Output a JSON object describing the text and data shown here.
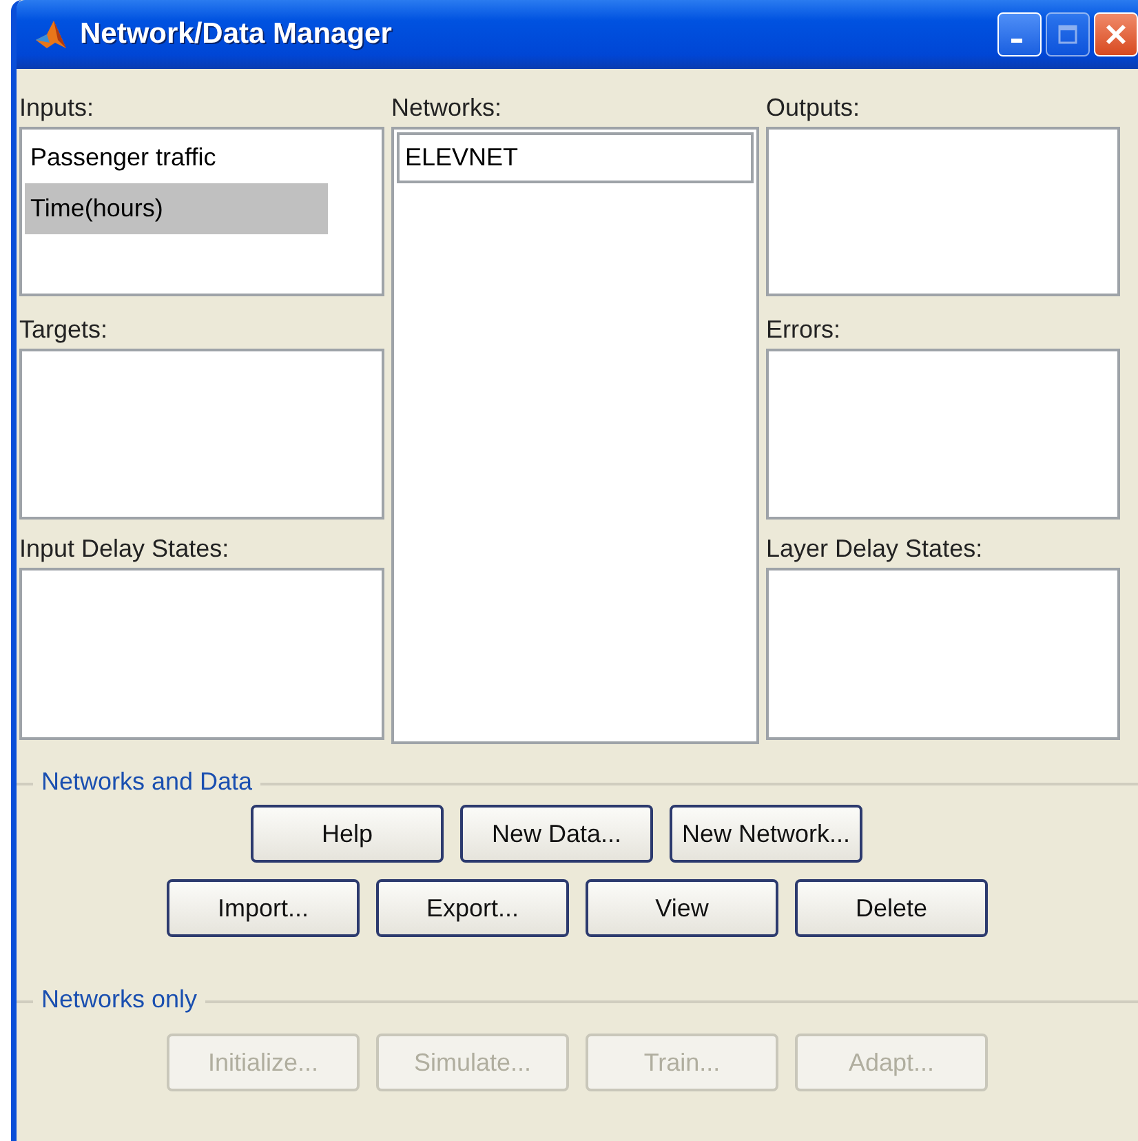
{
  "window": {
    "title": "Network/Data Manager"
  },
  "lists": [
    {
      "label": "Inputs:",
      "items": [
        {
          "text": "Passenger traffic",
          "selected": false
        },
        {
          "text": "Time(hours)",
          "selected": true
        }
      ]
    },
    {
      "label": "Networks:",
      "items": [
        {
          "text": "ELEVNET",
          "selected": true
        }
      ]
    },
    {
      "label": "Outputs:"
    },
    {
      "label": "Targets:"
    },
    {
      "label": "Errors:"
    },
    {
      "label": "Input Delay States:"
    },
    {
      "label": "Layer Delay States:"
    }
  ],
  "groups": [
    {
      "title": "Networks and Data",
      "rows": [
        [
          {
            "label": "Help",
            "disabled": false
          },
          {
            "label": "New Data...",
            "disabled": false
          },
          {
            "label": "New Network...",
            "disabled": false
          }
        ],
        [
          {
            "label": "Import...",
            "disabled": false
          },
          {
            "label": "Export...",
            "disabled": false
          },
          {
            "label": "View",
            "disabled": false
          },
          {
            "label": "Delete",
            "disabled": false
          }
        ]
      ]
    },
    {
      "title": "Networks only",
      "rows": [
        [
          {
            "label": "Initialize...",
            "disabled": true
          },
          {
            "label": "Simulate...",
            "disabled": true
          },
          {
            "label": "Train...",
            "disabled": true
          },
          {
            "label": "Adapt...",
            "disabled": true
          }
        ]
      ]
    }
  ]
}
